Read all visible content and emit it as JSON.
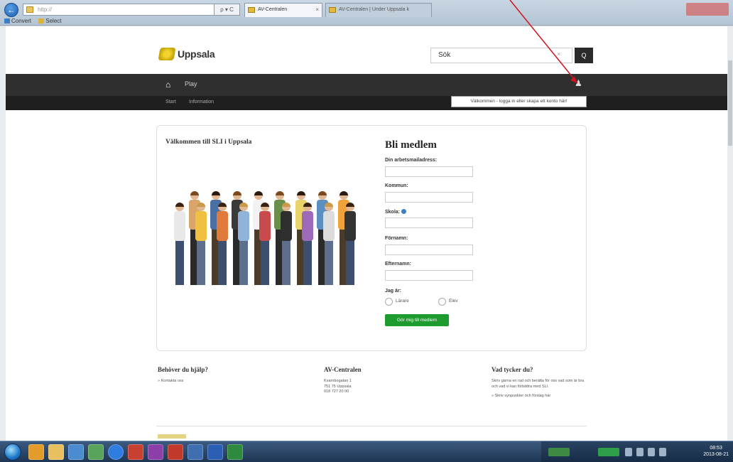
{
  "browser": {
    "back_label": "←",
    "address": "http://",
    "address_tools": "ρ ▾ C",
    "tabs": [
      {
        "label": "AV-Centralen",
        "close": "×"
      },
      {
        "label": "AV-Centralen | Under Uppsala k"
      }
    ],
    "toolbar": {
      "convert_label": "Convert",
      "select_label": "Select"
    }
  },
  "site": {
    "logo_text": "Uppsala",
    "search": {
      "value": "Sök",
      "clear": "×",
      "button": "Q"
    },
    "nav": {
      "home_icon": "home-icon",
      "home_glyph": "⌂",
      "play_label": "Play",
      "user_glyph": "♟",
      "sub_items": [
        "Start",
        "Information"
      ]
    },
    "tooltip": "Välkommen - logga in eller skapa ett konto här!"
  },
  "card": {
    "welcome_title": "Välkommen till SLI i Uppsala",
    "form": {
      "title": "Bli medlem",
      "fields": [
        {
          "label": "Din arbetsmailadress:"
        },
        {
          "label": "Kommun:"
        },
        {
          "label": "Skola:"
        },
        {
          "label": "Förnamn:"
        },
        {
          "label": "Efternamn:"
        }
      ],
      "role_label": "Jag är:",
      "roles": [
        "Lärare",
        "Elev"
      ],
      "submit_label": "Gör mig till medlem"
    }
  },
  "footer": {
    "help": {
      "title": "Behöver du hjälp?",
      "lines": [
        "» Kontakta oss"
      ]
    },
    "contact": {
      "title": "AV-Centralen",
      "lines": [
        "Kvarnbogatan 1",
        "751 75 Uppsala",
        "018 727 20 00"
      ]
    },
    "feedback": {
      "title": "Vad tycker du?",
      "text": "Skriv gärna en rad och berätta för oss vad som är bra och vad vi kan förbättra med SLI.",
      "link": "» Skriv synpunkter och förslag här"
    }
  },
  "colors": {
    "nav_bg": "#2f2f2f",
    "subnav_bg": "#1f1f1f",
    "submit_green": "#1e9b2f",
    "annotation_red": "#d0141e"
  },
  "taskbar": {
    "clock_time": "08:53",
    "clock_date": "2013-08-21"
  }
}
